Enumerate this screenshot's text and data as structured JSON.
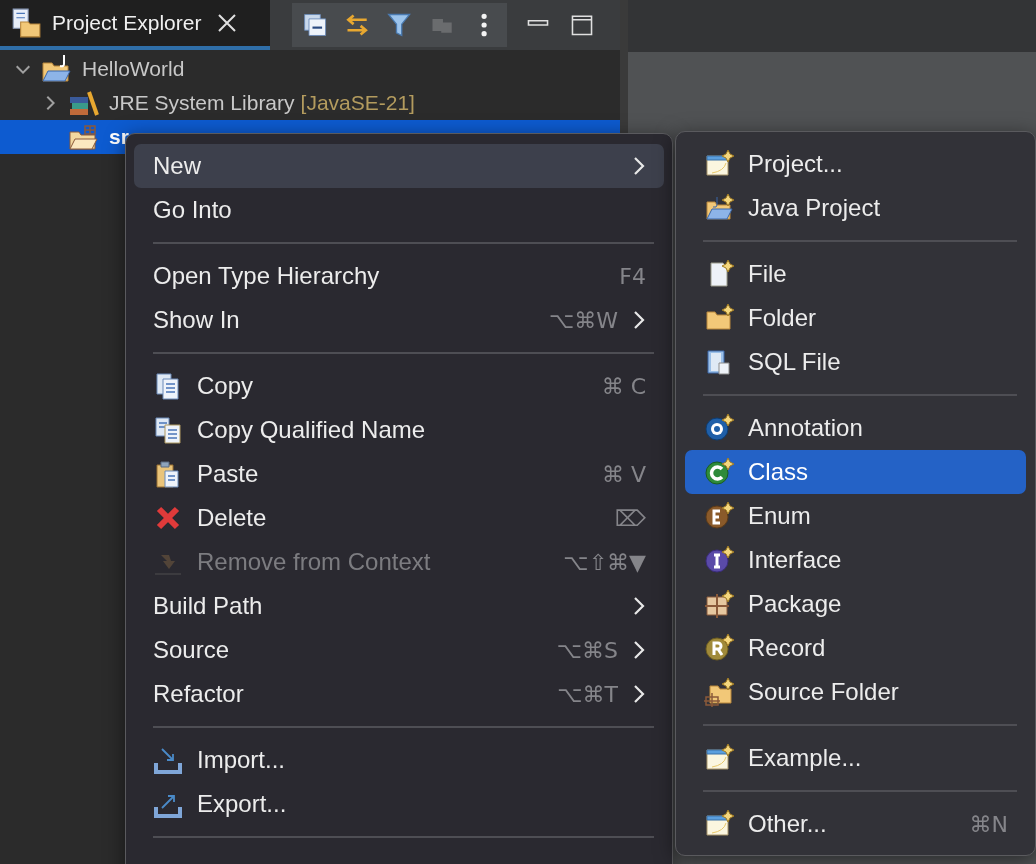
{
  "panel": {
    "tab": {
      "title": "Project Explorer",
      "selected": true
    }
  },
  "tree": [
    {
      "label": "HelloWorld",
      "expanded": true,
      "selected": false,
      "children": [
        {
          "label": "JRE System Library",
          "decoration": "[JavaSE-21]",
          "expanded": false,
          "selected": false
        },
        {
          "label": "sr",
          "selected": true
        }
      ]
    }
  ],
  "context_menu": {
    "items": [
      {
        "kind": "item",
        "label": "New",
        "submenu": true,
        "disabled": false,
        "selected": true
      },
      {
        "kind": "item",
        "label": "Go Into",
        "submenu": false,
        "disabled": false,
        "selected": false
      },
      {
        "kind": "separator"
      },
      {
        "kind": "item",
        "label": "Open Type Hierarchy",
        "shortcut": "F4",
        "submenu": false,
        "disabled": false,
        "selected": false
      },
      {
        "kind": "item",
        "label": "Show In",
        "shortcut": "⌥⌘W",
        "submenu": true,
        "disabled": false,
        "selected": false
      },
      {
        "kind": "separator"
      },
      {
        "kind": "item",
        "label": "Copy",
        "shortcut": "⌘ C",
        "submenu": false,
        "disabled": false,
        "selected": false
      },
      {
        "kind": "item",
        "label": "Copy Qualified Name",
        "submenu": false,
        "disabled": false,
        "selected": false
      },
      {
        "kind": "item",
        "label": "Paste",
        "shortcut": "⌘ V",
        "submenu": false,
        "disabled": false,
        "selected": false
      },
      {
        "kind": "item",
        "label": "Delete",
        "shortcut": "⌦",
        "submenu": false,
        "disabled": false,
        "selected": false
      },
      {
        "kind": "item",
        "label": "Remove from Context",
        "shortcut": "⌥⇧⌘▼",
        "submenu": false,
        "disabled": true,
        "selected": false
      },
      {
        "kind": "item",
        "label": "Build Path",
        "submenu": true,
        "disabled": false,
        "selected": false
      },
      {
        "kind": "item",
        "label": "Source",
        "shortcut": "⌥⌘S",
        "submenu": true,
        "disabled": false,
        "selected": false
      },
      {
        "kind": "item",
        "label": "Refactor",
        "shortcut": "⌥⌘T",
        "submenu": true,
        "disabled": false,
        "selected": false
      },
      {
        "kind": "separator"
      },
      {
        "kind": "item",
        "label": "Import...",
        "submenu": false,
        "disabled": false,
        "selected": false
      },
      {
        "kind": "item",
        "label": "Export...",
        "submenu": false,
        "disabled": false,
        "selected": false
      },
      {
        "kind": "separator"
      }
    ]
  },
  "submenu": {
    "items": [
      {
        "kind": "item",
        "label": "Project...",
        "selected": false
      },
      {
        "kind": "item",
        "label": "Java Project",
        "selected": false
      },
      {
        "kind": "separator"
      },
      {
        "kind": "item",
        "label": "File",
        "selected": false
      },
      {
        "kind": "item",
        "label": "Folder",
        "selected": false
      },
      {
        "kind": "item",
        "label": "SQL File",
        "selected": false
      },
      {
        "kind": "separator"
      },
      {
        "kind": "item",
        "label": "Annotation",
        "selected": false
      },
      {
        "kind": "item",
        "label": "Class",
        "selected": true
      },
      {
        "kind": "item",
        "label": "Enum",
        "selected": false
      },
      {
        "kind": "item",
        "label": "Interface",
        "selected": false
      },
      {
        "kind": "item",
        "label": "Package",
        "selected": false
      },
      {
        "kind": "item",
        "label": "Record",
        "selected": false
      },
      {
        "kind": "item",
        "label": "Source Folder",
        "selected": false
      },
      {
        "kind": "separator"
      },
      {
        "kind": "item",
        "label": "Example...",
        "selected": false
      },
      {
        "kind": "separator"
      },
      {
        "kind": "item",
        "label": "Other...",
        "shortcut": "⌘N",
        "selected": false
      }
    ]
  }
}
